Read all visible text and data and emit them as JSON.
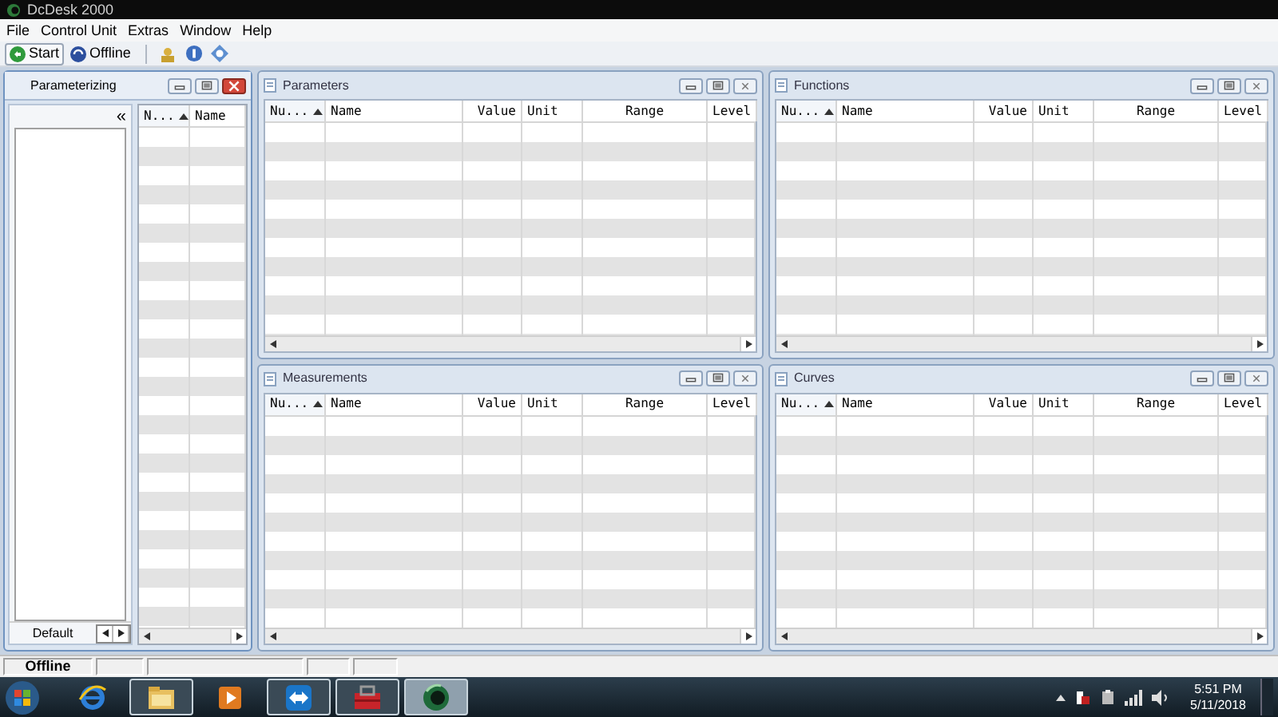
{
  "window": {
    "title": "DcDesk 2000"
  },
  "menu": [
    "File",
    "Control Unit",
    "Extras",
    "Window",
    "Help"
  ],
  "toolbar": [
    {
      "kind": "start",
      "label": "Start"
    },
    {
      "kind": "offline",
      "label": "Offline"
    }
  ],
  "parameterizing": {
    "title": "Parameterizing",
    "collapse": "«",
    "footer": "Default",
    "columns": [
      {
        "label": "N...",
        "sorted": true
      },
      {
        "label": "Name",
        "sorted": false
      }
    ]
  },
  "panels": [
    {
      "title": "Parameters",
      "columns": [
        {
          "label": "Nu...",
          "sorted": true
        },
        {
          "label": "Name",
          "sorted": false
        },
        {
          "label": "Value",
          "sorted": false
        },
        {
          "label": "Unit",
          "sorted": false
        },
        {
          "label": "Range",
          "sorted": false
        },
        {
          "label": "Level",
          "sorted": false
        }
      ]
    },
    {
      "title": "Functions",
      "columns": [
        {
          "label": "Nu...",
          "sorted": true
        },
        {
          "label": "Name",
          "sorted": false
        },
        {
          "label": "Value",
          "sorted": false
        },
        {
          "label": "Unit",
          "sorted": false
        },
        {
          "label": "Range",
          "sorted": false
        },
        {
          "label": "Level",
          "sorted": false
        }
      ]
    },
    {
      "title": "Measurements",
      "columns": [
        {
          "label": "Nu...",
          "sorted": true
        },
        {
          "label": "Name",
          "sorted": false
        },
        {
          "label": "Value",
          "sorted": false
        },
        {
          "label": "Unit",
          "sorted": false
        },
        {
          "label": "Range",
          "sorted": false
        },
        {
          "label": "Level",
          "sorted": false
        }
      ]
    },
    {
      "title": "Curves",
      "columns": [
        {
          "label": "Nu...",
          "sorted": true
        },
        {
          "label": "Name",
          "sorted": false
        },
        {
          "label": "Value",
          "sorted": false
        },
        {
          "label": "Unit",
          "sorted": false
        },
        {
          "label": "Range",
          "sorted": false
        },
        {
          "label": "Level",
          "sorted": false
        }
      ]
    }
  ],
  "status_bar": [
    "Offline"
  ],
  "taskbar": {
    "apps": [
      {
        "kind": "browser",
        "running": false,
        "selected": false
      },
      {
        "kind": "folder",
        "running": true,
        "selected": false
      },
      {
        "kind": "player",
        "running": false,
        "selected": false
      },
      {
        "kind": "remote",
        "running": true,
        "selected": false
      },
      {
        "kind": "toolbox",
        "running": true,
        "selected": false
      },
      {
        "kind": "dcdesk",
        "running": true,
        "selected": true
      }
    ],
    "time": "5:51 PM",
    "date": "5/11/2018"
  }
}
